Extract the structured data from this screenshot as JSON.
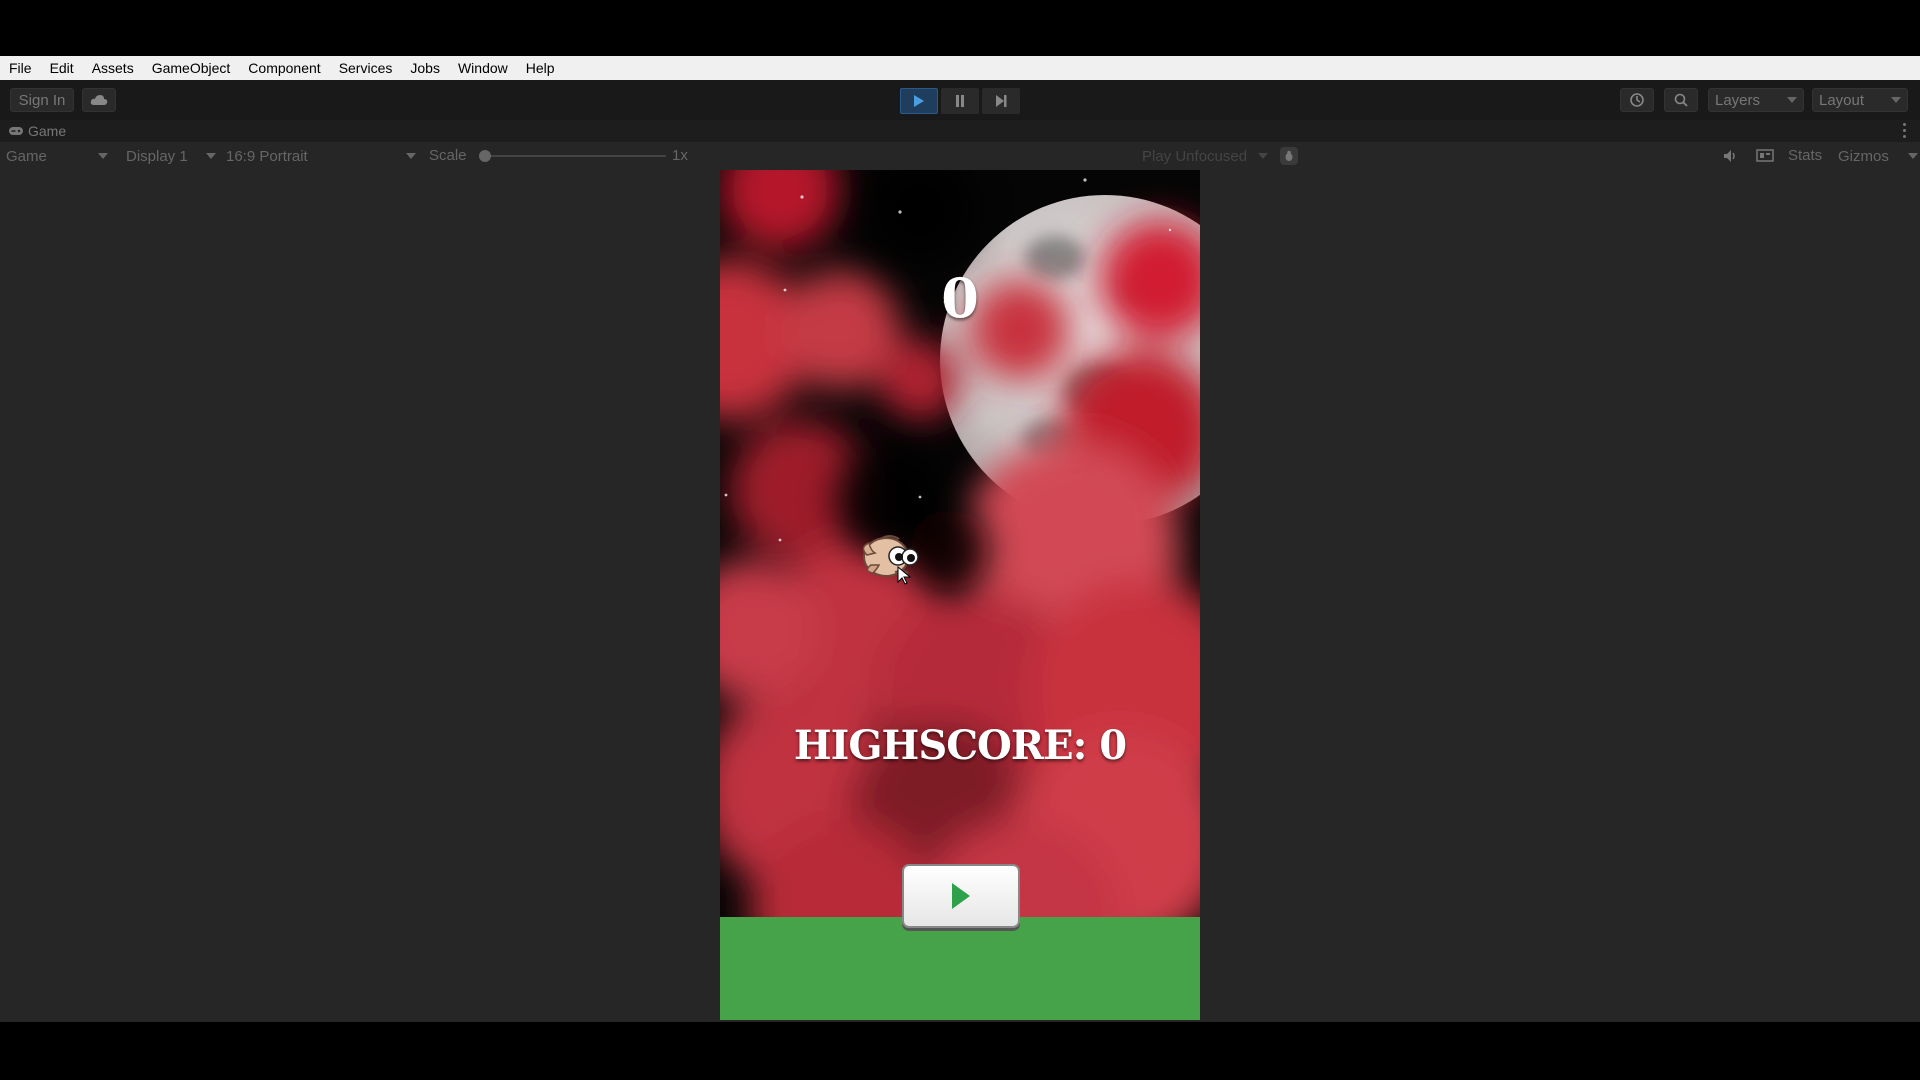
{
  "menu": [
    "File",
    "Edit",
    "Assets",
    "GameObject",
    "Component",
    "Services",
    "Jobs",
    "Window",
    "Help"
  ],
  "toolbar": {
    "sign_in": "Sign In",
    "layers": "Layers",
    "layout": "Layout"
  },
  "tab": {
    "label": "Game"
  },
  "game_toolbar": {
    "mode": "Game",
    "display": "Display 1",
    "aspect": "16:9 Portrait",
    "scale_label": "Scale",
    "scale_value": "1x",
    "play_focus": "Play Unfocused",
    "stats": "Stats",
    "gizmos": "Gizmos"
  },
  "game": {
    "score": "0",
    "highscore": "HIGHSCORE: 0"
  },
  "colors": {
    "ground": "#47a34a",
    "play_accent": "#2ea24a",
    "editor_bg": "#262626"
  }
}
